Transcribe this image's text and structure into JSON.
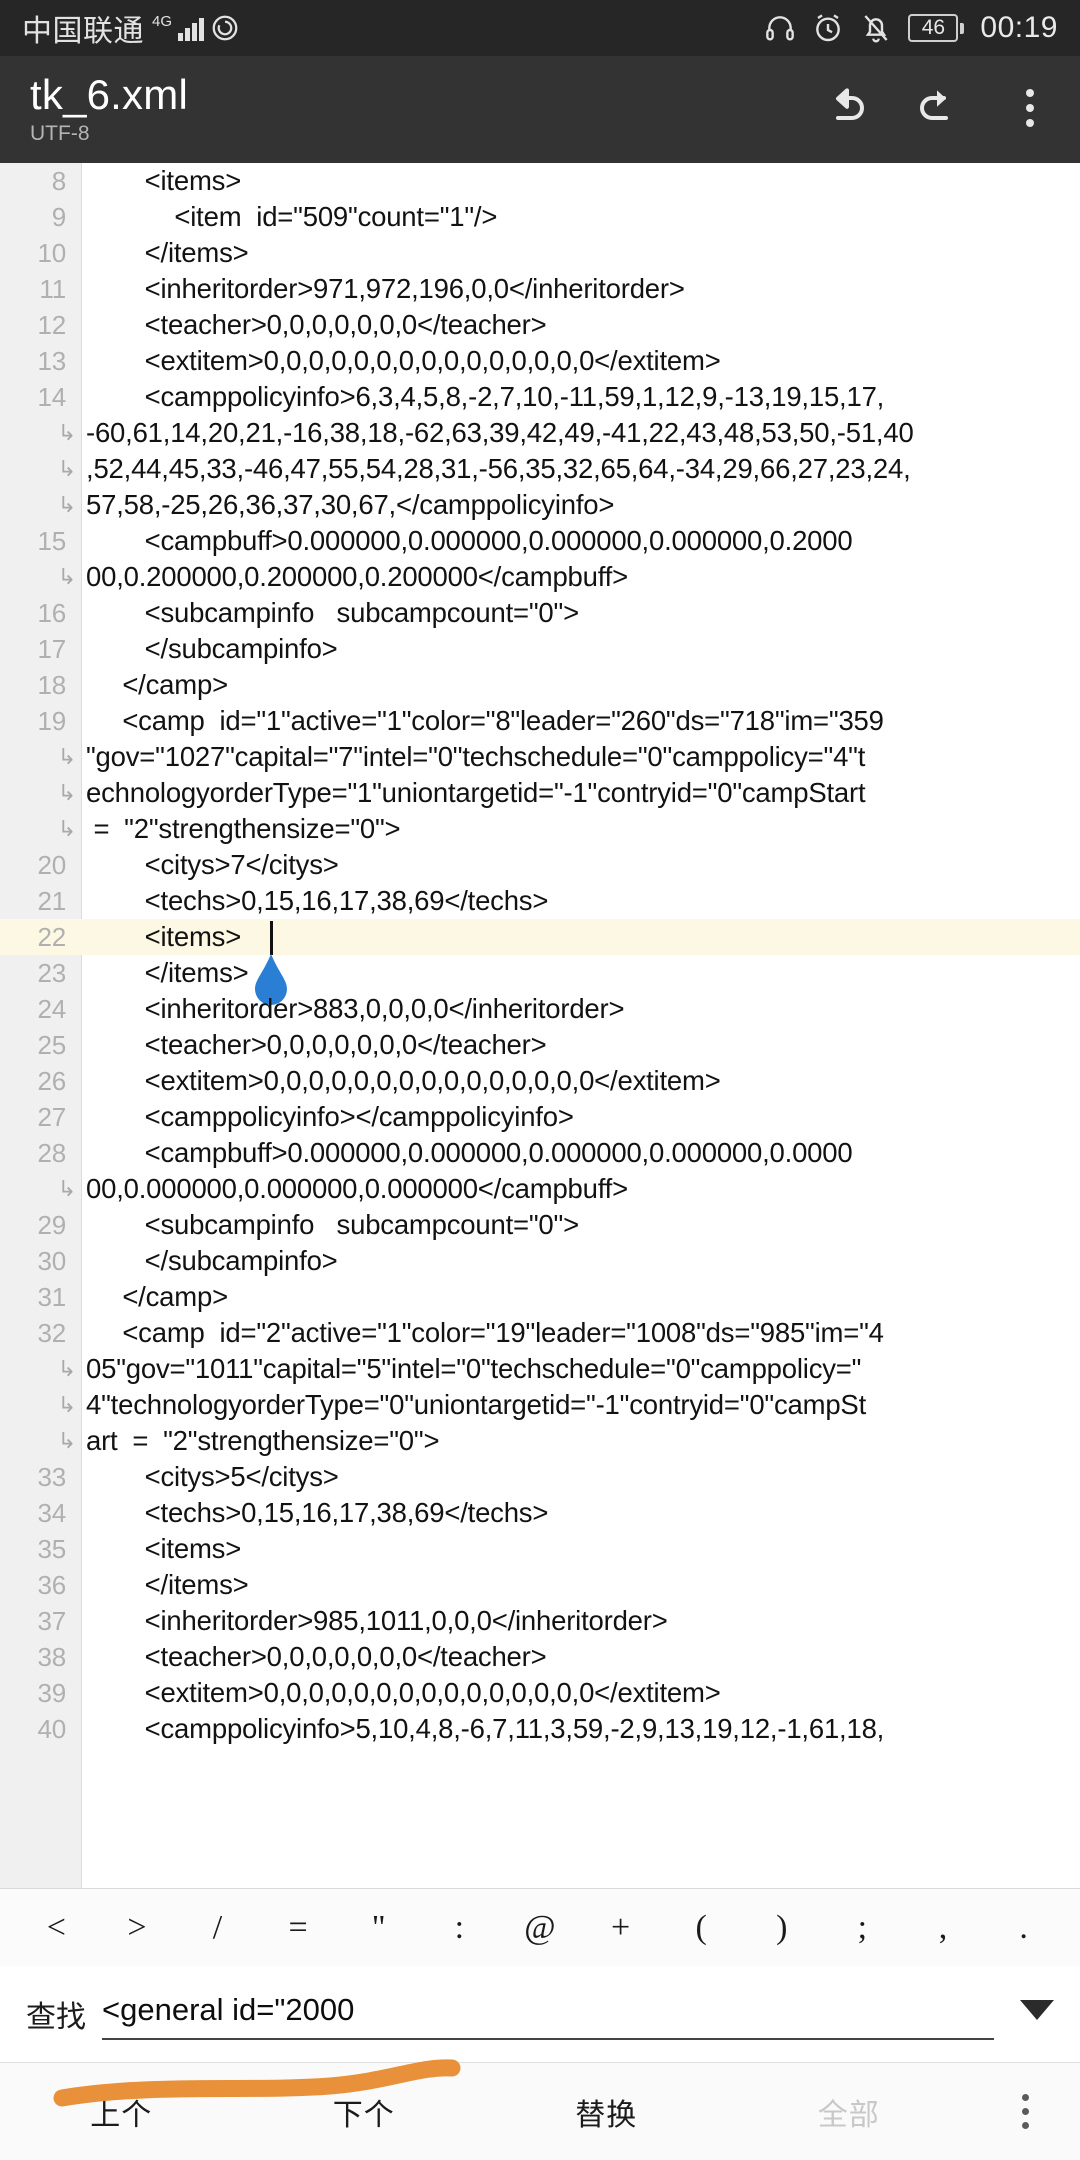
{
  "statusbar": {
    "carrier": "中国联通",
    "network": "4G",
    "battery_level": "46",
    "time": "00:19",
    "icons": [
      "headset-icon",
      "alarm-icon",
      "bell-muted-icon",
      "battery-icon"
    ]
  },
  "appbar": {
    "title": "tk_6.xml",
    "subtitle": "UTF-8",
    "actions": [
      "undo-icon",
      "redo-icon",
      "overflow-menu-icon"
    ]
  },
  "editor": {
    "highlighted_line": 22,
    "lines": [
      {
        "num": "8",
        "text": "      <items>"
      },
      {
        "num": "9",
        "text": "          <item  id=\"509\"count=\"1\"/>"
      },
      {
        "num": "10",
        "text": "      </items>"
      },
      {
        "num": "11",
        "text": "      <inheritorder>971,972,196,0,0</inheritorder>"
      },
      {
        "num": "12",
        "text": "      <teacher>0,0,0,0,0,0,0</teacher>"
      },
      {
        "num": "13",
        "text": "      <extitem>0,0,0,0,0,0,0,0,0,0,0,0,0,0,0</extitem>"
      },
      {
        "num": "14",
        "text": "      <camppolicyinfo>6,3,4,5,8,-2,7,10,-11,59,1,12,9,-13,19,15,17,"
      },
      {
        "num": "",
        "wrap": true,
        "text": "-60,61,14,20,21,-16,38,18,-62,63,39,42,49,-41,22,43,48,53,50,-51,40"
      },
      {
        "num": "",
        "wrap": true,
        "text": ",52,44,45,33,-46,47,55,54,28,31,-56,35,32,65,64,-34,29,66,27,23,24,"
      },
      {
        "num": "",
        "wrap": true,
        "text": "57,58,-25,26,36,37,30,67,</camppolicyinfo>"
      },
      {
        "num": "15",
        "text": "      <campbuff>0.000000,0.000000,0.000000,0.000000,0.2000"
      },
      {
        "num": "",
        "wrap": true,
        "text": "00,0.200000,0.200000,0.200000</campbuff>"
      },
      {
        "num": "16",
        "text": "      <subcampinfo   subcampcount=\"0\">"
      },
      {
        "num": "17",
        "text": "      </subcampinfo>"
      },
      {
        "num": "18",
        "text": "   </camp>"
      },
      {
        "num": "19",
        "text": "   <camp  id=\"1\"active=\"1\"color=\"8\"leader=\"260\"ds=\"718\"im=\"359"
      },
      {
        "num": "",
        "wrap": true,
        "text": "\"gov=\"1027\"capital=\"7\"intel=\"0\"techschedule=\"0\"camppolicy=\"4\"t"
      },
      {
        "num": "",
        "wrap": true,
        "text": "echnologyorderType=\"1\"uniontargetid=\"-1\"contryid=\"0\"campStart"
      },
      {
        "num": "",
        "wrap": true,
        "text": " =  \"2\"strengthensize=\"0\">"
      },
      {
        "num": "20",
        "text": "      <citys>7</citys>"
      },
      {
        "num": "21",
        "text": "      <techs>0,15,16,17,38,69</techs>"
      },
      {
        "num": "22",
        "text": "      <items>",
        "highlight": true,
        "caret": true
      },
      {
        "num": "23",
        "text": "      </items>"
      },
      {
        "num": "24",
        "text": "      <inheritorder>883,0,0,0,0</inheritorder>"
      },
      {
        "num": "25",
        "text": "      <teacher>0,0,0,0,0,0,0</teacher>"
      },
      {
        "num": "26",
        "text": "      <extitem>0,0,0,0,0,0,0,0,0,0,0,0,0,0,0</extitem>"
      },
      {
        "num": "27",
        "text": "      <camppolicyinfo></camppolicyinfo>"
      },
      {
        "num": "28",
        "text": "      <campbuff>0.000000,0.000000,0.000000,0.000000,0.0000"
      },
      {
        "num": "",
        "wrap": true,
        "text": "00,0.000000,0.000000,0.000000</campbuff>"
      },
      {
        "num": "29",
        "text": "      <subcampinfo   subcampcount=\"0\">"
      },
      {
        "num": "30",
        "text": "      </subcampinfo>"
      },
      {
        "num": "31",
        "text": "   </camp>"
      },
      {
        "num": "32",
        "text": "   <camp  id=\"2\"active=\"1\"color=\"19\"leader=\"1008\"ds=\"985\"im=\"4"
      },
      {
        "num": "",
        "wrap": true,
        "text": "05\"gov=\"1011\"capital=\"5\"intel=\"0\"techschedule=\"0\"camppolicy=\""
      },
      {
        "num": "",
        "wrap": true,
        "text": "4\"technologyorderType=\"0\"uniontargetid=\"-1\"contryid=\"0\"campSt"
      },
      {
        "num": "",
        "wrap": true,
        "text": "art  =  \"2\"strengthensize=\"0\">"
      },
      {
        "num": "33",
        "text": "      <citys>5</citys>"
      },
      {
        "num": "34",
        "text": "      <techs>0,15,16,17,38,69</techs>"
      },
      {
        "num": "35",
        "text": "      <items>"
      },
      {
        "num": "36",
        "text": "      </items>"
      },
      {
        "num": "37",
        "text": "      <inheritorder>985,1011,0,0,0</inheritorder>"
      },
      {
        "num": "38",
        "text": "      <teacher>0,0,0,0,0,0,0</teacher>"
      },
      {
        "num": "39",
        "text": "      <extitem>0,0,0,0,0,0,0,0,0,0,0,0,0,0,0</extitem>"
      },
      {
        "num": "40",
        "text": "      <camppolicyinfo>5,10,4,8,-6,7,11,3,59,-2,9,13,19,12,-1,61,18,"
      }
    ]
  },
  "symbolbar": {
    "symbols": [
      "<",
      ">",
      "/",
      "=",
      "\"",
      ":",
      "@",
      "+",
      "(",
      ")",
      ";",
      ",",
      "."
    ]
  },
  "findbar": {
    "label": "查找",
    "value": "<general id=\"2000",
    "placeholder": "",
    "dropdown_icon": "chevron-down-icon"
  },
  "actionbar": {
    "prev": "上个",
    "next": "下个",
    "replace": "替换",
    "replace_all": "全部",
    "overflow_icon": "overflow-menu-icon"
  },
  "colors": {
    "statusbar_bg": "#262626",
    "appbar_bg": "#333333",
    "editor_bg": "#ffffff",
    "gutter_bg": "#f0f0f0",
    "highlight_line": "#fdf8e3",
    "handle_blue": "#2a7fd4",
    "annotation_orange": "#e8903a"
  }
}
